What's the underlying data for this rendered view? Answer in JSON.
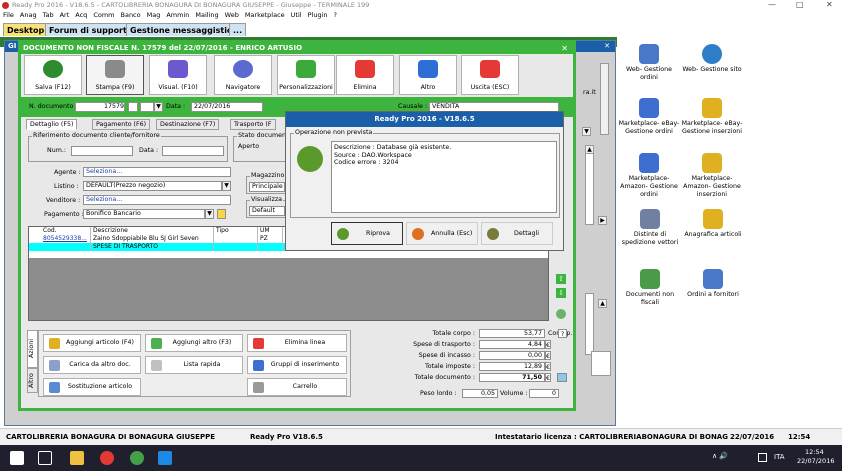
{
  "window": {
    "title": "Ready Pro 2016 - V18.6.5 - CARTOLIBRERIA BONAGURA DI BONAGURA GIUSEPPE - Giuseppe - TERMINALE 199",
    "min_glyph": "—",
    "max_glyph": "□",
    "close_glyph": "✕"
  },
  "menu": [
    "File",
    "Anag",
    "Tab",
    "Art",
    "Acq",
    "Comm",
    "Banco",
    "Mag",
    "Ammin",
    "Mailing",
    "Web",
    "Marketplace",
    "Util",
    "Plugin",
    "?"
  ],
  "tabs": [
    {
      "label": "Desktop"
    },
    {
      "label": "Forum di supporto"
    },
    {
      "label": "Gestione messaggistica"
    },
    {
      "label": "..."
    }
  ],
  "outer_window": {
    "title": "GI",
    "close_glyph": "✕"
  },
  "doc": {
    "title": "DOCUMENTO NON FISCALE N. 17579 del 22/07/2016 - ENRICO ARTUSIO",
    "close_glyph": "✕",
    "toolbar": [
      {
        "label": "Salva (F12)",
        "color": "#2e8b2e"
      },
      {
        "label": "Stampa (F9)",
        "color": "#8a8a8a"
      },
      {
        "label": "Visual. (F10)",
        "color": "#6a5acd"
      },
      {
        "label": "Navigatore",
        "color": "#5a6ad0"
      },
      {
        "label": "Personalizzazioni",
        "color": "#3aaa3a"
      },
      {
        "label": "Elimina",
        "color": "#e53935"
      },
      {
        "label": "Altro",
        "color": "#2e6fd6"
      },
      {
        "label": "Uscita (ESC)",
        "color": "#e53935"
      }
    ],
    "n_documento_label": "N. documento :",
    "n_documento": "17579",
    "data_label": "Data :",
    "data": "22/07/2016",
    "causale_label": "Causale :",
    "causale": "VENDITA",
    "subtabs": [
      "Dettaglio (F5)",
      "Pagamento (F6)",
      "Destinazione (F7)",
      "Trasporto (F"
    ],
    "rif_title": "Riferimento documento cliente/fornitore",
    "num_label": "Num.:",
    "data2_label": "Data :",
    "stato_label": "Stato documen",
    "stato_value": "Aperto",
    "agente_label": "Agente :",
    "agente_value": "Seleziona...",
    "listino_label": "Listino :",
    "listino_value": "DEFAULT(Prezzo negozio)",
    "venditore_label": "Venditore :",
    "venditore_value": "Seleziona...",
    "pagamento_label": "Pagamento :",
    "pagamento_value": "Bonifico Bancario",
    "magazzino_label": "Magazzino",
    "magazzino_value": "Principale",
    "visual_label": "Visualizza",
    "visual_value": "Default",
    "grid_headers": [
      "Cod.",
      "Descrizione",
      "Tipo",
      "UM"
    ],
    "grid_rows": [
      {
        "cod": "8054529338...",
        "desc": "Zaino Sdoppiabile Blu SJ Girl Seven",
        "tipo": "",
        "um": "PZ"
      },
      {
        "cod": "",
        "desc": "SPESE DI TRASPORTO",
        "tipo": "",
        "um": ""
      }
    ],
    "actions_tab": "Azioni",
    "altro_tab": "Altro",
    "actions": [
      {
        "label": "Aggiungi articolo (F4)"
      },
      {
        "label": "Aggiungi altro (F3)"
      },
      {
        "label": "Elimina linea"
      },
      {
        "label": "Carica da altro doc."
      },
      {
        "label": "Lista rapida"
      },
      {
        "label": "Gruppi di inserimento"
      },
      {
        "label": "Sostituzione articolo"
      },
      {
        "label": "Carrello"
      }
    ],
    "totals": [
      {
        "label": "Totale corpo :",
        "value": "53,77",
        "cur": "Corrisp."
      },
      {
        "label": "Spese di trasporto :",
        "value": "4,84",
        "cur": "€"
      },
      {
        "label": "Spese di incasso :",
        "value": "0,00",
        "cur": "€"
      },
      {
        "label": "Totale imposte :",
        "value": "12,89",
        "cur": "€"
      },
      {
        "label": "Totale documento :",
        "value": "71,50",
        "cur": "€"
      }
    ],
    "peso_label": "Peso lordo :",
    "peso_value": "0,05",
    "volume_label": "Volume :",
    "volume_value": "0",
    "help_glyph": "?",
    "side_text": "ra.it"
  },
  "dialog": {
    "title": "Ready Pro 2016 - V18.6.5",
    "group": "Operazione non prevista",
    "msg1": "Descrizione : Database già esistente.",
    "msg2": "Source : DAO.Workspace",
    "msg3": "Codice errore : 3204",
    "riprova": "Riprova",
    "annulla": "Annulla (Esc)",
    "dettagli": "Dettagli"
  },
  "desktop_icons": [
    {
      "label": "Web- Gestione ordini",
      "color": "#4a78c8"
    },
    {
      "label": "Web- Gestione sito",
      "color": "#2e7dc8"
    },
    {
      "label": "Marketplace- eBay- Gestione ordini",
      "color": "#3e6fd0"
    },
    {
      "label": "Marketplace- eBay- Gestione inserzioni",
      "color": "#e0b020"
    },
    {
      "label": "Marketplace- Amazon- Gestione ordini",
      "color": "#3e6fd0"
    },
    {
      "label": "Marketplace- Amazon- Gestione inserzioni",
      "color": "#e0b020"
    },
    {
      "label": "Distinte di spedizione vettori",
      "color": "#7080a0"
    },
    {
      "label": "Anagrafica articoli",
      "color": "#e0b020"
    },
    {
      "label": "Documenti non fiscali",
      "color": "#4a9a4a"
    },
    {
      "label": "Ordini a fornitori",
      "color": "#4a78c8"
    }
  ],
  "status": {
    "company": "CARTOLIBRERIA BONAGURA DI BONAGURA GIUSEPPE",
    "version": "Ready Pro V18.6.5",
    "license": "Intestatario licenza : CARTOLIBRERIABONAGURA DI BONAGURA G",
    "date": "22/07/2016",
    "time": "12:54"
  },
  "taskbar": {
    "time": "12:54",
    "date": "22/07/2016",
    "lang": "ITA",
    "tray": "∧ 🔊"
  }
}
